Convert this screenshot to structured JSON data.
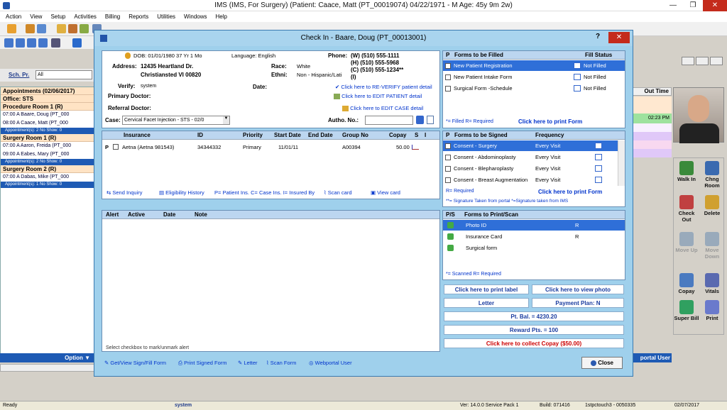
{
  "window": {
    "title": "IMS (IMS, For Surgery)    (Patient: Caace, Matt  (PT_00019074) 04/22/1971 - M Age: 45y 9m 2w)"
  },
  "menu": [
    "Action",
    "View",
    "Setup",
    "Activities",
    "Billing",
    "Reports",
    "Utilities",
    "Windows",
    "Help"
  ],
  "sidebar": {
    "sch_label": "Sch. Pr.",
    "sch_value": "All",
    "appointments_title": "Appointments (02/06/2017)",
    "office": "Office: STS",
    "rooms": [
      {
        "name": "Procedure Room 1 (R)",
        "items": [
          "07:00 A  Baare, Doug  (PT_000",
          "08:00 A  Caace, Matt  (PT_000"
        ],
        "summary": "Appointment(s): 2   No Show: 0"
      },
      {
        "name": "Surgery Room 1 (R)",
        "items": [
          "07:00 A  Aaron, Freida  (PT_000",
          "09:00 A  Eabes, Mary  (PT_000"
        ],
        "summary": "Appointment(s): 2   No Show: 0"
      },
      {
        "name": "Surgery Room 2 (R)",
        "items": [
          "07:00 A  Dabas, Mike  (PT_000"
        ],
        "summary": "Appointment(s): 1   No Show: 0"
      }
    ],
    "option": "Option"
  },
  "right_pane": {
    "out_time": "Out Time",
    "time_value": "02:23 PM",
    "actions": [
      "Walk In",
      "Chng Room",
      "Check Out",
      "Delete",
      "Move Up",
      "Move Down",
      "Copay",
      "Vitals",
      "Super Bill",
      "Print"
    ],
    "portal": "portal User"
  },
  "dialog": {
    "title": "Check In - Baare, Doug  (PT_00013001)",
    "help": "?",
    "close_x": "✕",
    "patient": {
      "dob": "DOB: 01/01/1980  37 Yr 1 Mo",
      "language": "Language: English",
      "address_label": "Address:",
      "address1": "12435 Heartland Dr.",
      "address2": "Christiansted  VI  00820",
      "race_label": "Race:",
      "race": "White",
      "ethni_label": "Ethni:",
      "ethni": "Non - Hispanic/Lati",
      "phone_label": "Phone:",
      "phone_w": "(W)  (510) 555-1111",
      "phone_h": "(H)  (510) 555-5968",
      "phone_c": "(C)  (510) 555-1234**",
      "phone_i": "(I)",
      "verify_label": "Verify:",
      "verify": "system",
      "date_label": "Date:",
      "primary_doctor": "Primary Doctor:",
      "referral_doctor": "Referral Doctor:",
      "reverify": "Click here to RE-VERIFY patient detail",
      "edit_patient": "Click here to EDIT PATIENT detail",
      "edit_case": "Click here to EDIT CASE detail",
      "case_label": "Case:",
      "case_value": "Cervical Facet Injection  - STS - 02/0",
      "autho_label": "Autho. No.:"
    },
    "insurance": {
      "headers": [
        "Insurance",
        "ID",
        "Priority",
        "Start Date",
        "End Date",
        "Group No",
        "Copay",
        "S",
        "I"
      ],
      "row": {
        "p": "P",
        "name": "Aetna   (Aetna 981543)",
        "id": "34344332",
        "priority": "Primary",
        "start": "11/01/11",
        "end": "",
        "group": "A00394",
        "copay": "50.00"
      },
      "links": [
        "Send Inquiry",
        "Eligibility History",
        "P= Patient Ins. C= Case Ins. I= Insured By",
        "Scan card",
        "View card"
      ]
    },
    "alerts": {
      "headers": [
        "Alert",
        "Active",
        "Date",
        "Note"
      ],
      "footer": "Select checkbox to mark/unmark alert"
    },
    "forms_filled": {
      "headers": [
        "P",
        "Forms to be Filled",
        "Fill Status"
      ],
      "rows": [
        [
          "New Patient Registration",
          "Not Filled"
        ],
        [
          "New Patient Intake Form",
          "Not Filled"
        ],
        [
          "Surgical Form -Schedule",
          "Not Filled"
        ]
      ],
      "legend": "*= Filled   R= Required",
      "print": "Click here to print Form"
    },
    "forms_signed": {
      "headers": [
        "P",
        "Forms to be Signed",
        "Frequency"
      ],
      "rows": [
        [
          "Consent - Surgery",
          "Every Visit"
        ],
        [
          "Consent - Abdominoplasty",
          "Every Visit"
        ],
        [
          "Consent - Blepharoplasty",
          "Every Visit"
        ],
        [
          "Consent - Breast Augmentation",
          "Every Visit"
        ]
      ],
      "legend": "R= Required",
      "print": "Click here to print Form",
      "note": "**= Signature Taken from portal  *=Signature taken from IMS"
    },
    "forms_scan": {
      "headers": [
        "P/S",
        "Forms to Print/Scan"
      ],
      "rows": [
        [
          "Photo ID",
          "R"
        ],
        [
          "Insurance Card",
          "R"
        ],
        [
          "Surgical form",
          ""
        ]
      ],
      "legend": "*= Scanned   R= Required"
    },
    "buttons": {
      "print_label": "Click here to print label",
      "view_photo": "Click here to view photo",
      "letter": "Letter",
      "payment_plan": "Payment Plan: N",
      "pt_bal": "Pt. Bal. = 4230.20",
      "reward": "Reward Pts. = 100",
      "collect": "Click here to collect Copay ($50.00)"
    },
    "footer_links": [
      "Get/View Sign/Fill Form",
      "Print Signed Form",
      "Letter",
      "Scan Form",
      "Webportal User"
    ],
    "close": "Close"
  },
  "status": {
    "ready": "Ready",
    "user": "system",
    "version": "Ver: 14.0.0 Service Pack 1",
    "build": "Build: 071416",
    "server": "1stpctouch3 - 0050335",
    "date": "02/07/2017"
  },
  "colors": {
    "accent": "#1e5ab4",
    "selected": "#2f6fd8",
    "collect": "#cc0000",
    "link": "#0033cc"
  }
}
